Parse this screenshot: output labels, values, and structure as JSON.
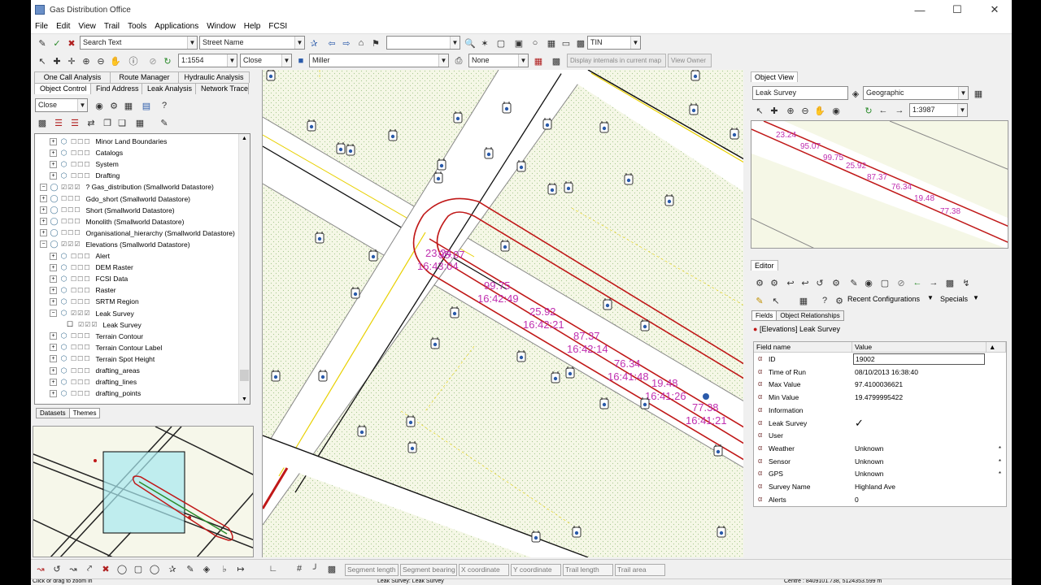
{
  "window": {
    "title": "Gas Distribution Office"
  },
  "menu": [
    "File",
    "Edit",
    "View",
    "Trail",
    "Tools",
    "Applications",
    "Window",
    "Help",
    "FCSI"
  ],
  "toolbar1": {
    "search_text": "Search Text",
    "street_name": "Street Name",
    "layer_combo": "",
    "tin_combo": "TIN"
  },
  "toolbar2": {
    "scale": "1:1554",
    "close_combo": "Close",
    "user_combo": "Miller",
    "none_combo": "None",
    "display_internals": "Display internals in current map",
    "view_owner": "View Owner"
  },
  "left_tabs_row1": [
    "One Call Analysis",
    "Route Manager",
    "Hydraulic Analysis"
  ],
  "left_tabs_row2": [
    "Object Control",
    "Find Address",
    "Leak Analysis",
    "Network Trace"
  ],
  "left_close_combo": "Close",
  "tree": [
    {
      "label": "Minor Land Boundaries",
      "indent": 2,
      "boxes": "☐☐☐"
    },
    {
      "label": "Catalogs",
      "indent": 2,
      "boxes": "☐☐☐"
    },
    {
      "label": "System",
      "indent": 2,
      "boxes": "☐☐☐"
    },
    {
      "label": "Drafting",
      "indent": 2,
      "boxes": "☐☐☐"
    },
    {
      "label": "? Gas_distribution (Smallworld Datastore)",
      "indent": 0,
      "boxes": "☑☑☑"
    },
    {
      "label": "Gdo_short (Smallworld Datastore)",
      "indent": 0,
      "boxes": "☐☐☐"
    },
    {
      "label": "Short (Smallworld Datastore)",
      "indent": 0,
      "boxes": "☐☐☐"
    },
    {
      "label": "Monolith (Smallworld Datastore)",
      "indent": 0,
      "boxes": "☐☐☐"
    },
    {
      "label": "Organisational_hierarchy (Smallworld Datastore)",
      "indent": 0,
      "boxes": "☐☐☐"
    },
    {
      "label": "Elevations (Smallworld Datastore)",
      "indent": 0,
      "boxes": "☑☑☑"
    },
    {
      "label": "Alert",
      "indent": 2,
      "boxes": "☐☐☐"
    },
    {
      "label": "DEM Raster",
      "indent": 2,
      "boxes": "☐☐☐"
    },
    {
      "label": "FCSI Data",
      "indent": 2,
      "boxes": "☐☐☐"
    },
    {
      "label": "Raster",
      "indent": 2,
      "boxes": "☐☐☐"
    },
    {
      "label": "SRTM Region",
      "indent": 2,
      "boxes": "☐☐☐"
    },
    {
      "label": "Leak Survey",
      "indent": 2,
      "boxes": "☑☑☑"
    },
    {
      "label": "Leak Survey",
      "indent": 3,
      "boxes": "☑☑☑"
    },
    {
      "label": "Terrain Contour",
      "indent": 2,
      "boxes": "☐☐☐"
    },
    {
      "label": "Terrain Contour Label",
      "indent": 2,
      "boxes": "☐☐☐"
    },
    {
      "label": "Terrain Spot Height",
      "indent": 2,
      "boxes": "☐☐☐"
    },
    {
      "label": "drafting_areas",
      "indent": 2,
      "boxes": "☐☐☐"
    },
    {
      "label": "drafting_lines",
      "indent": 2,
      "boxes": "☐☐☐"
    },
    {
      "label": "drafting_points",
      "indent": 2,
      "boxes": "☐☐☐"
    }
  ],
  "left_bottom_tabs": [
    "Datasets",
    "Themes"
  ],
  "map_labels": [
    {
      "value": "23.24",
      "time": "16:43:04"
    },
    {
      "value": "95.07",
      "time": ""
    },
    {
      "value": "99.75",
      "time": "16:42:49"
    },
    {
      "value": "25.92",
      "time": "16:42:21"
    },
    {
      "value": "87.37",
      "time": "16:42:14"
    },
    {
      "value": "76.34",
      "time": "16:41:48"
    },
    {
      "value": "19.48",
      "time": "16:41:26"
    },
    {
      "value": "77.38",
      "time": "16:41:21"
    }
  ],
  "object_view": {
    "tab": "Object View",
    "layer": "Leak Survey",
    "projection": "Geographic",
    "scale": "1:3987"
  },
  "editor": {
    "tab": "Editor",
    "recent_configurations": "Recent Configurations",
    "specials": "Specials",
    "subtabs": [
      "Fields",
      "Object Relationships"
    ],
    "record_title": "[Elevations] Leak Survey",
    "col_field": "Field name",
    "col_value": "Value",
    "fields": [
      {
        "name": "ID",
        "value": "19002",
        "mark": ""
      },
      {
        "name": "Time of Run",
        "value": "08/10/2013 16:38:40",
        "mark": ""
      },
      {
        "name": "Max Value",
        "value": "97.4100036621",
        "mark": ""
      },
      {
        "name": "Min Value",
        "value": "19.4799995422",
        "mark": ""
      },
      {
        "name": "Information",
        "value": "",
        "mark": ""
      },
      {
        "name": "Leak Survey",
        "value": "✓",
        "mark": ""
      },
      {
        "name": "User",
        "value": "",
        "mark": ""
      },
      {
        "name": "Weather",
        "value": "Unknown",
        "mark": "*"
      },
      {
        "name": "Sensor",
        "value": "Unknown",
        "mark": "*"
      },
      {
        "name": "GPS",
        "value": "Unknown",
        "mark": "*"
      },
      {
        "name": "Survey Name",
        "value": "Highland Ave",
        "mark": ""
      },
      {
        "name": "Alerts",
        "value": "0",
        "mark": ""
      }
    ]
  },
  "measure_fields": [
    "Segment length",
    "Segment bearing",
    "X coordinate",
    "Y coordinate",
    "Trail length",
    "Trail area"
  ],
  "statusbar": {
    "hint": "Click or drag to zoom in",
    "object": "Leak Survey: Leak Survey",
    "centre": "Centre : 8409101.738, 5124353.599 m"
  },
  "colors": {
    "pipe_red": "#c01818",
    "label_magenta": "#c030b0",
    "road_yellow": "#e8d000",
    "land_fill": "#f5f7e6",
    "grass_dot": "#a8c890"
  }
}
